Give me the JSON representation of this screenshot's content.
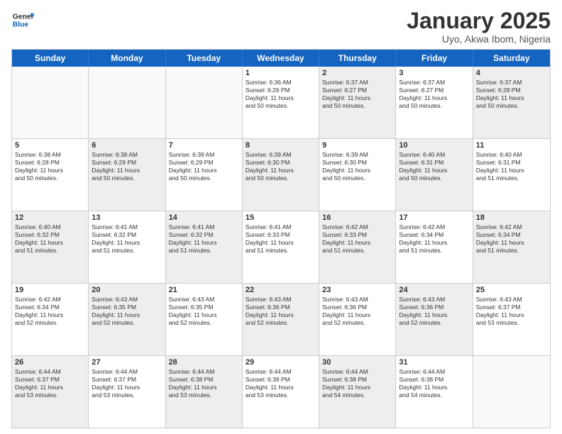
{
  "header": {
    "logo_general": "General",
    "logo_blue": "Blue",
    "month_title": "January 2025",
    "subtitle": "Uyo, Akwa Ibom, Nigeria"
  },
  "days_of_week": [
    "Sunday",
    "Monday",
    "Tuesday",
    "Wednesday",
    "Thursday",
    "Friday",
    "Saturday"
  ],
  "weeks": [
    [
      {
        "day": "",
        "info": "",
        "empty": true
      },
      {
        "day": "",
        "info": "",
        "empty": true
      },
      {
        "day": "",
        "info": "",
        "empty": true
      },
      {
        "day": "1",
        "info": "Sunrise: 6:36 AM\nSunset: 6:26 PM\nDaylight: 11 hours\nand 50 minutes.",
        "shaded": false
      },
      {
        "day": "2",
        "info": "Sunrise: 6:37 AM\nSunset: 6:27 PM\nDaylight: 11 hours\nand 50 minutes.",
        "shaded": true
      },
      {
        "day": "3",
        "info": "Sunrise: 6:37 AM\nSunset: 6:27 PM\nDaylight: 11 hours\nand 50 minutes.",
        "shaded": false
      },
      {
        "day": "4",
        "info": "Sunrise: 6:37 AM\nSunset: 6:28 PM\nDaylight: 11 hours\nand 50 minutes.",
        "shaded": true
      }
    ],
    [
      {
        "day": "5",
        "info": "Sunrise: 6:38 AM\nSunset: 6:28 PM\nDaylight: 11 hours\nand 50 minutes.",
        "shaded": false
      },
      {
        "day": "6",
        "info": "Sunrise: 6:38 AM\nSunset: 6:29 PM\nDaylight: 11 hours\nand 50 minutes.",
        "shaded": true
      },
      {
        "day": "7",
        "info": "Sunrise: 6:39 AM\nSunset: 6:29 PM\nDaylight: 11 hours\nand 50 minutes.",
        "shaded": false
      },
      {
        "day": "8",
        "info": "Sunrise: 6:39 AM\nSunset: 6:30 PM\nDaylight: 11 hours\nand 50 minutes.",
        "shaded": true
      },
      {
        "day": "9",
        "info": "Sunrise: 6:39 AM\nSunset: 6:30 PM\nDaylight: 11 hours\nand 50 minutes.",
        "shaded": false
      },
      {
        "day": "10",
        "info": "Sunrise: 6:40 AM\nSunset: 6:31 PM\nDaylight: 11 hours\nand 50 minutes.",
        "shaded": true
      },
      {
        "day": "11",
        "info": "Sunrise: 6:40 AM\nSunset: 6:31 PM\nDaylight: 11 hours\nand 51 minutes.",
        "shaded": false
      }
    ],
    [
      {
        "day": "12",
        "info": "Sunrise: 6:40 AM\nSunset: 6:32 PM\nDaylight: 11 hours\nand 51 minutes.",
        "shaded": true
      },
      {
        "day": "13",
        "info": "Sunrise: 6:41 AM\nSunset: 6:32 PM\nDaylight: 11 hours\nand 51 minutes.",
        "shaded": false
      },
      {
        "day": "14",
        "info": "Sunrise: 6:41 AM\nSunset: 6:32 PM\nDaylight: 11 hours\nand 51 minutes.",
        "shaded": true
      },
      {
        "day": "15",
        "info": "Sunrise: 6:41 AM\nSunset: 6:33 PM\nDaylight: 11 hours\nand 51 minutes.",
        "shaded": false
      },
      {
        "day": "16",
        "info": "Sunrise: 6:42 AM\nSunset: 6:33 PM\nDaylight: 11 hours\nand 51 minutes.",
        "shaded": true
      },
      {
        "day": "17",
        "info": "Sunrise: 6:42 AM\nSunset: 6:34 PM\nDaylight: 11 hours\nand 51 minutes.",
        "shaded": false
      },
      {
        "day": "18",
        "info": "Sunrise: 6:42 AM\nSunset: 6:34 PM\nDaylight: 11 hours\nand 51 minutes.",
        "shaded": true
      }
    ],
    [
      {
        "day": "19",
        "info": "Sunrise: 6:42 AM\nSunset: 6:34 PM\nDaylight: 11 hours\nand 52 minutes.",
        "shaded": false
      },
      {
        "day": "20",
        "info": "Sunrise: 6:43 AM\nSunset: 6:35 PM\nDaylight: 11 hours\nand 52 minutes.",
        "shaded": true
      },
      {
        "day": "21",
        "info": "Sunrise: 6:43 AM\nSunset: 6:35 PM\nDaylight: 11 hours\nand 52 minutes.",
        "shaded": false
      },
      {
        "day": "22",
        "info": "Sunrise: 6:43 AM\nSunset: 6:36 PM\nDaylight: 11 hours\nand 52 minutes.",
        "shaded": true
      },
      {
        "day": "23",
        "info": "Sunrise: 6:43 AM\nSunset: 6:36 PM\nDaylight: 11 hours\nand 52 minutes.",
        "shaded": false
      },
      {
        "day": "24",
        "info": "Sunrise: 6:43 AM\nSunset: 6:36 PM\nDaylight: 11 hours\nand 52 minutes.",
        "shaded": true
      },
      {
        "day": "25",
        "info": "Sunrise: 6:43 AM\nSunset: 6:37 PM\nDaylight: 11 hours\nand 53 minutes.",
        "shaded": false
      }
    ],
    [
      {
        "day": "26",
        "info": "Sunrise: 6:44 AM\nSunset: 6:37 PM\nDaylight: 11 hours\nand 53 minutes.",
        "shaded": true
      },
      {
        "day": "27",
        "info": "Sunrise: 6:44 AM\nSunset: 6:37 PM\nDaylight: 11 hours\nand 53 minutes.",
        "shaded": false
      },
      {
        "day": "28",
        "info": "Sunrise: 6:44 AM\nSunset: 6:38 PM\nDaylight: 11 hours\nand 53 minutes.",
        "shaded": true
      },
      {
        "day": "29",
        "info": "Sunrise: 6:44 AM\nSunset: 6:38 PM\nDaylight: 11 hours\nand 53 minutes.",
        "shaded": false
      },
      {
        "day": "30",
        "info": "Sunrise: 6:44 AM\nSunset: 6:38 PM\nDaylight: 11 hours\nand 54 minutes.",
        "shaded": true
      },
      {
        "day": "31",
        "info": "Sunrise: 6:44 AM\nSunset: 6:38 PM\nDaylight: 11 hours\nand 54 minutes.",
        "shaded": false
      },
      {
        "day": "",
        "info": "",
        "empty": true
      }
    ]
  ]
}
